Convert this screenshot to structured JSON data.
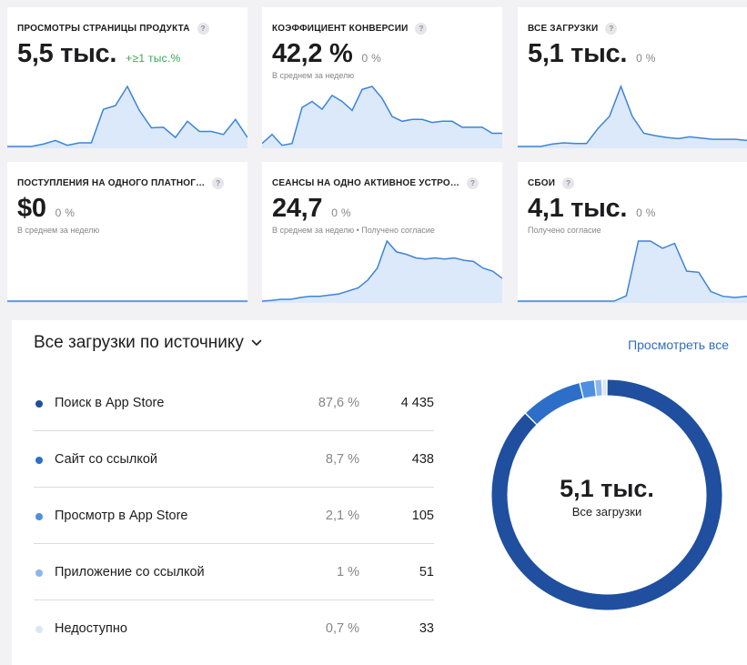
{
  "metrics": [
    {
      "title": "ПРОСМОТРЫ СТРАНИЦЫ ПРОДУКТА",
      "value": "5,5 тыс.",
      "delta": "+≥1 тыс.%",
      "delta_positive": true,
      "sub": "",
      "series": [
        0,
        0,
        0,
        0.04,
        0.1,
        0.02,
        0.06,
        0.06,
        0.62,
        0.68,
        1,
        0.6,
        0.31,
        0.32,
        0.15,
        0.42,
        0.25,
        0.25,
        0.2,
        0.45,
        0.15
      ]
    },
    {
      "title": "КОЭФФИЦИЕНТ КОНВЕРСИИ",
      "value": "42,2 %",
      "delta": "0 %",
      "delta_positive": false,
      "sub": "В среднем за неделю",
      "series": [
        0.05,
        0.2,
        0.02,
        0.05,
        0.65,
        0.75,
        0.62,
        0.85,
        0.75,
        0.6,
        0.95,
        1,
        0.8,
        0.5,
        0.42,
        0.45,
        0.45,
        0.4,
        0.42,
        0.42,
        0.32,
        0.32,
        0.32,
        0.22,
        0.22
      ]
    },
    {
      "title": "ВСЕ ЗАГРУЗКИ",
      "value": "5,1 тыс.",
      "delta": "0 %",
      "delta_positive": false,
      "sub": "",
      "series": [
        0,
        0,
        0,
        0.04,
        0.06,
        0.05,
        0.05,
        0.3,
        0.5,
        1,
        0.5,
        0.22,
        0.18,
        0.15,
        0.13,
        0.16,
        0.14,
        0.12,
        0.12,
        0.12,
        0.1
      ]
    },
    {
      "title": "ПОСТУПЛЕНИЯ НА ОДНОГО ПЛАТНОГ…",
      "value": "$0",
      "delta": "0 %",
      "delta_positive": false,
      "sub": "В среднем за неделю",
      "series": [
        0,
        0,
        0,
        0,
        0,
        0,
        0,
        0,
        0,
        0,
        0,
        0,
        0,
        0,
        0,
        0,
        0,
        0,
        0,
        0,
        0
      ]
    },
    {
      "title": "СЕАНСЫ НА ОДНО АКТИВНОЕ УСТРО…",
      "value": "24,7",
      "delta": "0 %",
      "delta_positive": false,
      "sub": "В среднем за неделю • Получено согласие",
      "series": [
        0,
        0.01,
        0.03,
        0.03,
        0.06,
        0.08,
        0.08,
        0.1,
        0.12,
        0.17,
        0.22,
        0.35,
        0.55,
        1,
        0.82,
        0.78,
        0.72,
        0.7,
        0.72,
        0.7,
        0.72,
        0.68,
        0.66,
        0.55,
        0.5,
        0.38
      ]
    },
    {
      "title": "СБОИ",
      "value": "4,1 тыс.",
      "delta": "0 %",
      "delta_positive": false,
      "sub": "Получено согласие",
      "series": [
        0,
        0,
        0,
        0,
        0,
        0,
        0,
        0,
        0,
        0.09,
        1,
        1,
        0.88,
        0.96,
        0.5,
        0.48,
        0.16,
        0.08,
        0.06,
        0.08
      ]
    }
  ],
  "sources": {
    "title": "Все загрузки по источнику",
    "view_all": "Просмотреть все",
    "items": [
      {
        "label": "Поиск в App Store",
        "pct": "87,6 %",
        "count": "4 435",
        "share": 87.6,
        "color": "#1f4f9e"
      },
      {
        "label": "Сайт со ссылкой",
        "pct": "8,7 %",
        "count": "438",
        "share": 8.7,
        "color": "#2d6fc8"
      },
      {
        "label": "Просмотр в App Store",
        "pct": "2,1 %",
        "count": "105",
        "share": 2.1,
        "color": "#4f8fe0"
      },
      {
        "label": "Приложение со ссылкой",
        "pct": "1 %",
        "count": "51",
        "share": 1.0,
        "color": "#8bb6ee"
      },
      {
        "label": "Недоступно",
        "pct": "0,7 %",
        "count": "33",
        "share": 0.7,
        "color": "#d9e6f8"
      }
    ],
    "total": "5,1 тыс.",
    "total_label": "Все загрузки"
  },
  "colors": {
    "accent": "#2f6fbe",
    "line": "#3d84d6",
    "fill": "#dbe9fa",
    "green": "#34a853"
  }
}
